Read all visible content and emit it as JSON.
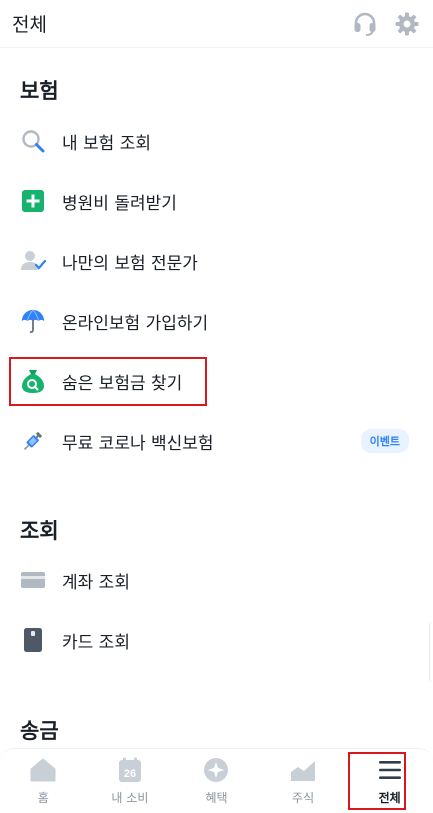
{
  "header": {
    "title": "전체",
    "support_icon": "headset-icon",
    "settings_icon": "gear-icon"
  },
  "sections": [
    {
      "title": "보험",
      "items": [
        {
          "label": "내 보험 조회",
          "icon": "search-icon"
        },
        {
          "label": "병원비 돌려받기",
          "icon": "plus-square-icon"
        },
        {
          "label": "나만의 보험 전문가",
          "icon": "user-check-icon"
        },
        {
          "label": "온라인보험 가입하기",
          "icon": "umbrella-icon"
        },
        {
          "label": "숨은 보험금 찾기",
          "icon": "money-bag-search-icon"
        },
        {
          "label": "무료 코로나 백신보험",
          "icon": "syringe-icon",
          "badge": "이벤트"
        }
      ]
    },
    {
      "title": "조회",
      "items": [
        {
          "label": "계좌 조회",
          "icon": "account-card-icon"
        },
        {
          "label": "카드 조회",
          "icon": "card-icon"
        }
      ]
    },
    {
      "title": "송금",
      "items": []
    }
  ],
  "tabbar": {
    "tabs": [
      {
        "label": "홈",
        "icon": "home-icon"
      },
      {
        "label": "내 소비",
        "icon": "calendar-icon",
        "icon_text": "26"
      },
      {
        "label": "혜택",
        "icon": "star-circle-icon"
      },
      {
        "label": "주식",
        "icon": "chart-icon"
      },
      {
        "label": "전체",
        "icon": "menu-icon",
        "active": true
      }
    ]
  },
  "colors": {
    "accent": "#3182f6",
    "highlight": "#d7191f",
    "green": "#16b36e",
    "icon_gray": "#b0b8c1"
  }
}
